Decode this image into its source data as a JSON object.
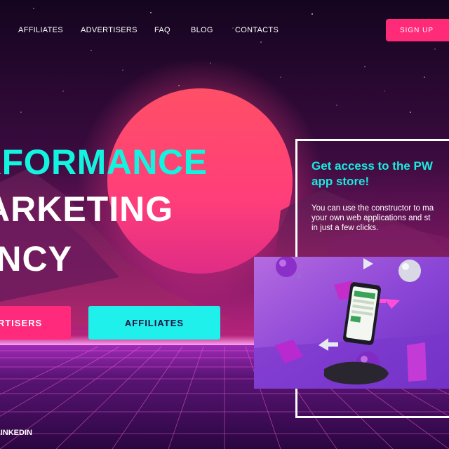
{
  "nav": {
    "items": [
      "AFFILIATES",
      "ADVERTISERS",
      "FAQ",
      "BLOG",
      "CONTACTS"
    ],
    "signup_label": "SIGN UP"
  },
  "hero": {
    "title_line1": "RFORMANCE",
    "title_line2": "ARKETING",
    "title_line3": "ENCY",
    "cta_advertisers": "RTISERS",
    "cta_affiliates": "AFFILIATES"
  },
  "social": {
    "linkedin_label": "LINKEDIN"
  },
  "promo": {
    "title_line1": "Get access to the PW",
    "title_line2": "app store!",
    "text_line1": "You can use the constructor to ma",
    "text_line2": "your own web applications and st",
    "text_line3": "in just a few clicks."
  },
  "colors": {
    "accent_pink": "#ff2a78",
    "accent_cyan": "#1ff0ec",
    "title_cyan": "#12f4e0",
    "background": "#12061f"
  }
}
